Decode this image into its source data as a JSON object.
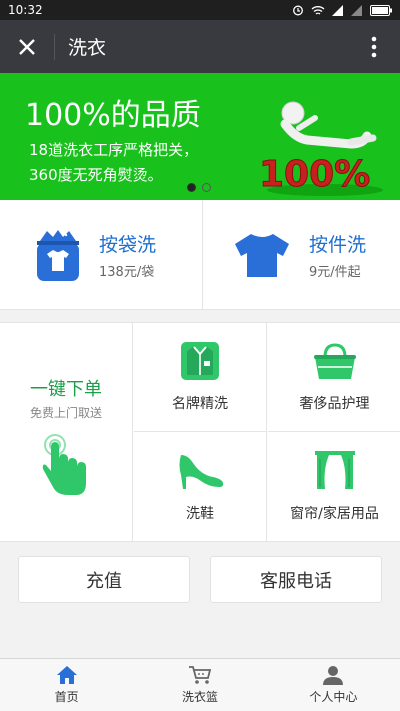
{
  "status_bar": {
    "time": "10:32"
  },
  "title_bar": {
    "title": "洗衣"
  },
  "banner": {
    "title": "100%的品质",
    "line1": "18道洗衣工序严格把关，",
    "line2": "360度无死角熨烫。",
    "badge_text": "100%",
    "active_slide": 1,
    "slide_count": 2
  },
  "wash_options": [
    {
      "title": "按袋洗",
      "price": "138元/袋"
    },
    {
      "title": "按件洗",
      "price": "9元/件起"
    }
  ],
  "quick_order": {
    "title": "一键下单",
    "subtitle": "免费上门取送"
  },
  "services": [
    {
      "label": "名牌精洗",
      "icon": "shirt-icon"
    },
    {
      "label": "奢侈品护理",
      "icon": "handbag-icon"
    },
    {
      "label": "洗鞋",
      "icon": "high-heel-icon"
    },
    {
      "label": "窗帘/家居用品",
      "icon": "curtain-icon"
    }
  ],
  "actions": {
    "recharge": "充值",
    "customer_service": "客服电话"
  },
  "bottom_nav": [
    {
      "label": "首页",
      "icon": "home-icon",
      "active": true
    },
    {
      "label": "洗衣篮",
      "icon": "cart-icon",
      "active": false
    },
    {
      "label": "个人中心",
      "icon": "user-icon",
      "active": false
    }
  ],
  "colors": {
    "banner_green": "#19c11c",
    "accent_blue": "#1f6fd1",
    "accent_green": "#2fc76a",
    "title_bar": "#393a3f"
  }
}
